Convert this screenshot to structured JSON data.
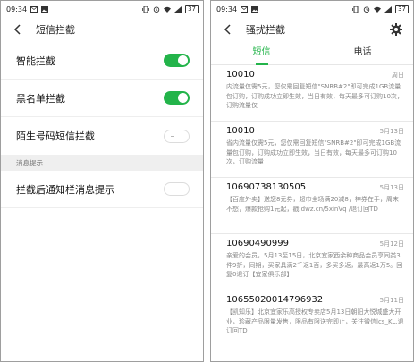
{
  "status_bar": {
    "time": "09:34",
    "battery": "37"
  },
  "left": {
    "title": "短信拦截",
    "settings": [
      {
        "label": "智能拦截",
        "enabled": true
      },
      {
        "label": "黑名单拦截",
        "enabled": true
      },
      {
        "label": "陌生号码短信拦截",
        "enabled": false
      }
    ],
    "section_header": "消息提示",
    "notify": {
      "label": "拦截后通知栏消息提示",
      "enabled": false
    }
  },
  "right": {
    "title": "骚扰拦截",
    "tabs": [
      {
        "label": "短信",
        "active": true
      },
      {
        "label": "电话",
        "active": false
      }
    ],
    "messages": [
      {
        "sender": "10010",
        "date": "周日",
        "preview": "内流量仅需5元，您仅需回复短信\"SNRB#2\"即可完成1GB流量包订购，订购成功立即生效，当日有效，每天最多可订购10次，订购流量仅"
      },
      {
        "sender": "10010",
        "date": "5月13日",
        "preview": "省内流量仅需5元，您仅需回复短信\"SNRB#2\"即可完成1GB流量包订购，订购成功立即生效，当日有效，每天最多可订购10次，订购流量"
      },
      {
        "sender": "10690738130505",
        "date": "5月13日",
        "preview": "【百度外卖】送您8元券，超市全场满20减8，神券在手，周末不愁，爆款抢购1元起，戳 dwz.cn/5xinVq /退订回TD"
      },
      {
        "sender": "10690490999",
        "date": "5月12日",
        "preview": "亲爱的会员，5月13至15日，北京宜家西余种商品会员享同类3件9折，同期，买家具满2千返1百，多买多返，最高返1万5。回复0退订【宜家俱乐部】"
      },
      {
        "sender": "10655020014796932",
        "date": "5月11日",
        "preview": "【凯知乐】北京宜家乐高授权专卖店5月13日朝阳大悦城盛大开业，珍藏产品限量发售，限品有限送完即止，关注微信lcs_KL,退订回TD"
      }
    ]
  },
  "colors": {
    "accent_green": "#23b44a",
    "section_bg": "#efefef",
    "muted_text": "#888888"
  },
  "icons": {
    "status_left": [
      "message-icon",
      "image-icon"
    ],
    "status_right": [
      "vibrate-icon",
      "alarm-icon",
      "wifi-icon",
      "signal-icon",
      "battery-icon"
    ],
    "back": "back-arrow-icon",
    "settings": "gear-icon"
  }
}
